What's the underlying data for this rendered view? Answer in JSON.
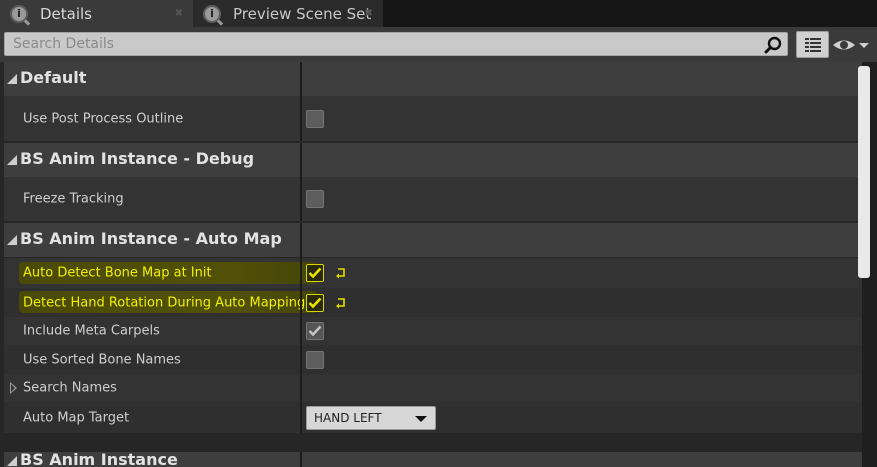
{
  "tabs": [
    {
      "label": "Details",
      "icon": "info-search-icon",
      "active": true
    },
    {
      "label": "Preview Scene Set",
      "icon": "info-search-icon",
      "active": false
    }
  ],
  "search": {
    "placeholder": "Search Details",
    "value": ""
  },
  "categories": [
    {
      "title": "Default"
    },
    {
      "title": "BS Anim Instance - Debug"
    },
    {
      "title": "BS Anim Instance - Auto Map"
    },
    {
      "title": "BS Anim Instance"
    }
  ],
  "properties": {
    "use_post_process_outline": {
      "label": "Use Post Process Outline",
      "checked": false
    },
    "freeze_tracking": {
      "label": "Freeze Tracking",
      "checked": false
    },
    "auto_detect_bone_map": {
      "label": "Auto Detect Bone Map at Init",
      "checked": true,
      "highlighted": true
    },
    "detect_hand_rotation": {
      "label": "Detect Hand Rotation During Auto Mapping",
      "checked": true,
      "highlighted": true
    },
    "include_meta_carpels": {
      "label": "Include Meta Carpels",
      "checked": true
    },
    "use_sorted_bone_names": {
      "label": "Use Sorted Bone Names",
      "checked": false
    },
    "search_names": {
      "label": "Search Names"
    },
    "auto_map_target": {
      "label": "Auto Map Target",
      "value": "HAND LEFT"
    }
  },
  "colors": {
    "highlight_text": "#f0f000",
    "panel_bg": "#262626",
    "category_bg": "#3e3e3e"
  }
}
